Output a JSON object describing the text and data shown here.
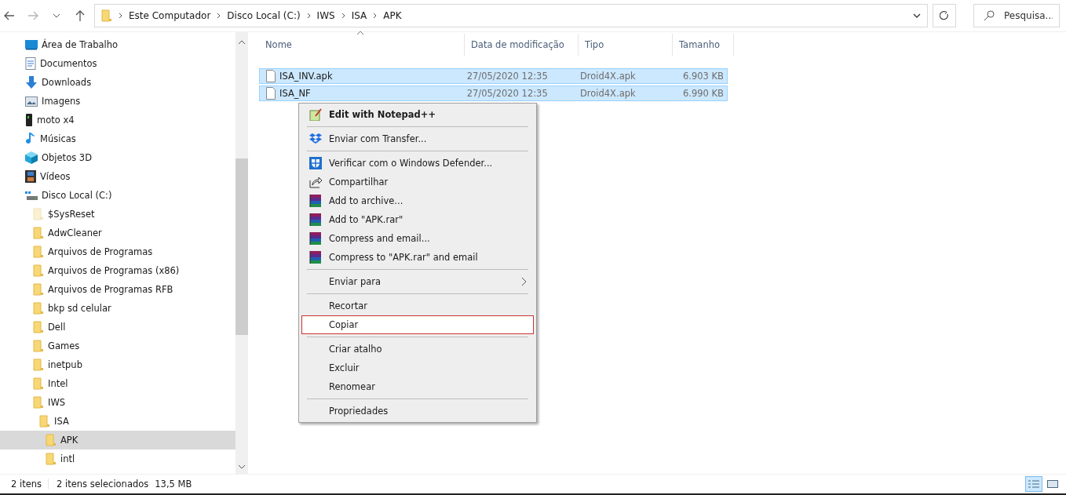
{
  "address_bar": {
    "crumbs": [
      "Este Computador",
      "Disco Local (C:)",
      "IWS",
      "ISA",
      "APK"
    ]
  },
  "search": {
    "placeholder": "Pesquisa..."
  },
  "sidebar": {
    "items": [
      {
        "label": "Área de Trabalho",
        "kind": "desktop",
        "selected": false
      },
      {
        "label": "Documentos",
        "kind": "documents",
        "selected": false
      },
      {
        "label": "Downloads",
        "kind": "downloads",
        "selected": false
      },
      {
        "label": "Imagens",
        "kind": "pictures",
        "selected": false
      },
      {
        "label": "moto x4",
        "kind": "phone",
        "selected": false
      },
      {
        "label": "Músicas",
        "kind": "music",
        "selected": false
      },
      {
        "label": "Objetos 3D",
        "kind": "cube",
        "selected": false
      },
      {
        "label": "Vídeos",
        "kind": "videos",
        "selected": false
      },
      {
        "label": "Disco Local (C:)",
        "kind": "drive",
        "selected": false,
        "children": [
          {
            "label": "$SysReset",
            "kind": "folder",
            "hidden": true,
            "selected": false
          },
          {
            "label": "AdwCleaner",
            "kind": "folder",
            "hidden": false,
            "selected": false
          },
          {
            "label": "Arquivos de Programas",
            "kind": "folder",
            "hidden": false,
            "selected": false
          },
          {
            "label": "Arquivos de Programas (x86)",
            "kind": "folder",
            "hidden": false,
            "selected": false
          },
          {
            "label": "Arquivos de Programas RFB",
            "kind": "folder",
            "hidden": false,
            "selected": false
          },
          {
            "label": "bkp sd celular",
            "kind": "folder",
            "hidden": false,
            "selected": false
          },
          {
            "label": "Dell",
            "kind": "folder",
            "hidden": false,
            "selected": false
          },
          {
            "label": "Games",
            "kind": "folder",
            "hidden": false,
            "selected": false
          },
          {
            "label": "inetpub",
            "kind": "folder",
            "hidden": false,
            "selected": false
          },
          {
            "label": "Intel",
            "kind": "folder",
            "hidden": false,
            "selected": false
          },
          {
            "label": "IWS",
            "kind": "folder",
            "hidden": false,
            "selected": false,
            "children": [
              {
                "label": "ISA",
                "kind": "folder",
                "hidden": false,
                "selected": false,
                "children": [
                  {
                    "label": "APK",
                    "kind": "folder",
                    "hidden": false,
                    "selected": true
                  },
                  {
                    "label": "intl",
                    "kind": "folder",
                    "hidden": false,
                    "selected": false
                  }
                ]
              }
            ]
          }
        ]
      }
    ]
  },
  "table": {
    "columns": [
      "Nome",
      "Data de modificação",
      "Tipo",
      "Tamanho"
    ],
    "rows": [
      {
        "name": "ISA_INV.apk",
        "modified": "27/05/2020 12:35",
        "type": "Droid4X.apk",
        "size": "6.903 KB",
        "selected": true
      },
      {
        "name": "ISA_NF",
        "modified": "27/05/2020 12:35",
        "type": "Droid4X.apk",
        "size": "6.990 KB",
        "selected": true
      }
    ]
  },
  "context_menu": {
    "groups": [
      [
        {
          "label": "Edit with Notepad++",
          "kind": "notepad",
          "default": true,
          "selected": false
        }
      ],
      [
        {
          "label": "Enviar com Transfer...",
          "kind": "dropbox",
          "default": false,
          "selected": false
        }
      ],
      [
        {
          "label": "Verificar com o Windows Defender...",
          "kind": "shield",
          "default": false,
          "selected": false
        },
        {
          "label": "Compartilhar",
          "kind": "share",
          "default": false,
          "selected": false
        },
        {
          "label": "Add to archive...",
          "kind": "rar",
          "default": false,
          "selected": false
        },
        {
          "label": "Add to \"APK.rar\"",
          "kind": "rar",
          "default": false,
          "selected": false
        },
        {
          "label": "Compress and email...",
          "kind": "rar",
          "default": false,
          "selected": false
        },
        {
          "label": "Compress to \"APK.rar\" and email",
          "kind": "rar",
          "default": false,
          "selected": false
        }
      ],
      [
        {
          "label": "Enviar para",
          "kind": "submenu",
          "default": false,
          "selected": false
        }
      ],
      [
        {
          "label": "Recortar",
          "kind": "plain",
          "default": false,
          "selected": false
        },
        {
          "label": "Copiar",
          "kind": "plain",
          "default": false,
          "selected": true
        }
      ],
      [
        {
          "label": "Criar atalho",
          "kind": "plain",
          "default": false,
          "selected": false
        },
        {
          "label": "Excluir",
          "kind": "plain",
          "default": false,
          "selected": false
        },
        {
          "label": "Renomear",
          "kind": "plain",
          "default": false,
          "selected": false
        }
      ],
      [
        {
          "label": "Propriedades",
          "kind": "plain",
          "default": false,
          "selected": false
        }
      ]
    ]
  },
  "status_bar": {
    "count": "2 itens",
    "selection": "2 itens selecionados",
    "size": "13,5 MB"
  },
  "views": [
    {
      "kind": "details",
      "selected": true
    },
    {
      "kind": "tiles",
      "selected": false
    }
  ]
}
